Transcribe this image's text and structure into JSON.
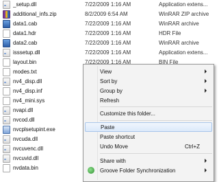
{
  "files": [
    {
      "name": "_setup.dll",
      "date": "7/22/2009 1:16 AM",
      "type": "Application extens...",
      "icon": "dll"
    },
    {
      "name": "additional_infs.zip",
      "date": "8/2/2009 6:54 AM",
      "type": "WinRAR ZIP archive",
      "icon": "zip"
    },
    {
      "name": "data1.cab",
      "date": "7/22/2009 1:16 AM",
      "type": "WinRAR archive",
      "icon": "cab"
    },
    {
      "name": "data1.hdr",
      "date": "7/22/2009 1:16 AM",
      "type": "HDR File",
      "icon": "hdr"
    },
    {
      "name": "data2.cab",
      "date": "7/22/2009 1:16 AM",
      "type": "WinRAR archive",
      "icon": "cab"
    },
    {
      "name": "isssetup.dll",
      "date": "7/22/2009 1:16 AM",
      "type": "Application extens...",
      "icon": "dll"
    },
    {
      "name": "layout.bin",
      "date": "7/22/2009 1:16 AM",
      "type": "BIN File",
      "icon": "bin"
    },
    {
      "name": "modes.txt",
      "date": "",
      "type": "",
      "icon": "txt"
    },
    {
      "name": "nv4_disp.dll",
      "date": "",
      "type": "",
      "icon": "dll"
    },
    {
      "name": "nv4_disp.inf",
      "date": "",
      "type": "",
      "icon": "inf"
    },
    {
      "name": "nv4_mini.sys",
      "date": "",
      "type": "",
      "icon": "sys"
    },
    {
      "name": "nvapi.dll",
      "date": "",
      "type": "",
      "icon": "dll"
    },
    {
      "name": "nvcod.dll",
      "date": "",
      "type": "",
      "icon": "dll"
    },
    {
      "name": "nvcplsetupint.exe",
      "date": "",
      "type": "",
      "icon": "exe"
    },
    {
      "name": "nvcuda.dll",
      "date": "",
      "type": "",
      "icon": "dll"
    },
    {
      "name": "nvcuvenc.dll",
      "date": "",
      "type": "",
      "icon": "dll"
    },
    {
      "name": "nvcuvid.dll",
      "date": "",
      "type": "",
      "icon": "dll"
    },
    {
      "name": "nvdata.bin",
      "date": "",
      "type": "",
      "icon": "bin"
    }
  ],
  "context_menu": {
    "view": "View",
    "sort_by": "Sort by",
    "group_by": "Group by",
    "refresh": "Refresh",
    "customize": "Customize this folder...",
    "paste": "Paste",
    "paste_shortcut": "Paste shortcut",
    "undo_move": "Undo Move",
    "undo_shortcut": "Ctrl+Z",
    "share_with": "Share with",
    "groove": "Groove Folder Synchronization"
  }
}
